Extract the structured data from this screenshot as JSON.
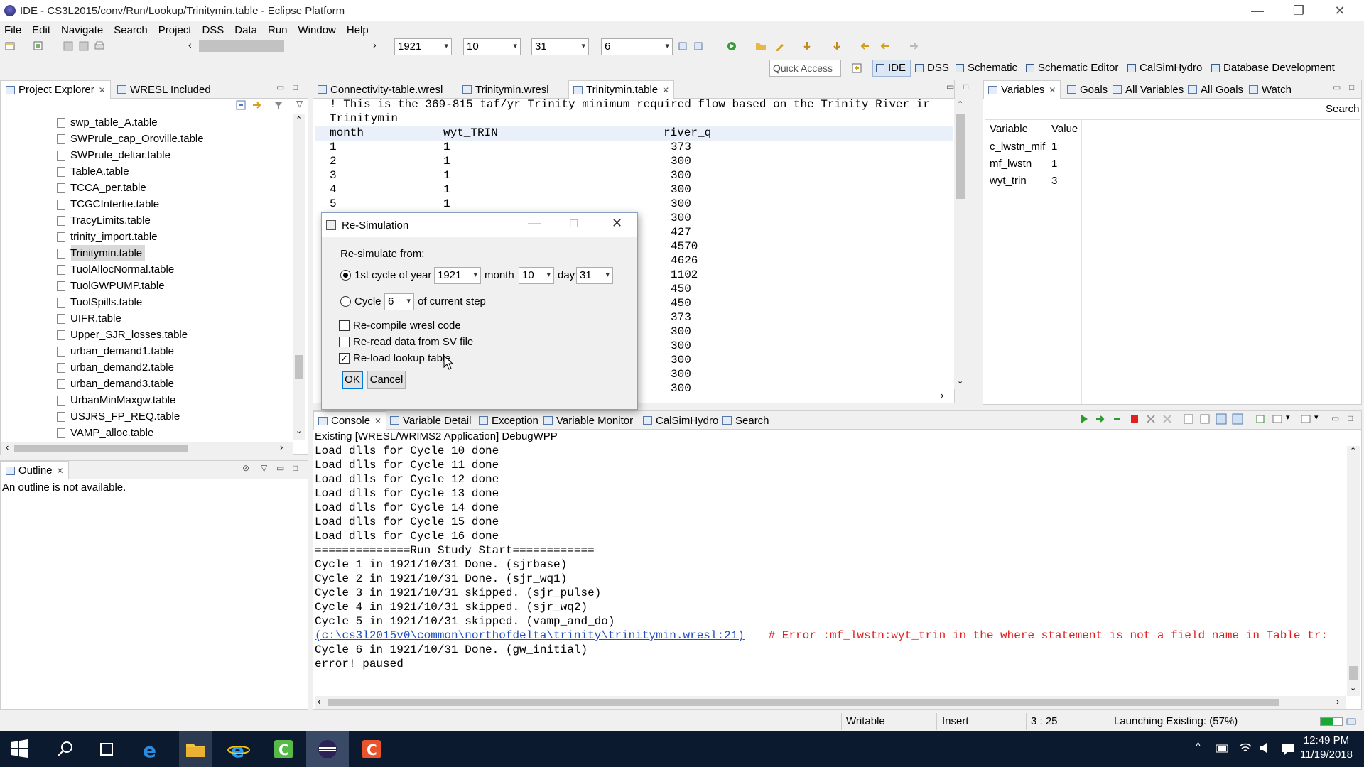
{
  "window": {
    "title": "IDE - CS3L2015/conv/Run/Lookup/Trinitymin.table - Eclipse Platform",
    "minimize": "—",
    "maximize": "❐",
    "close": "✕"
  },
  "menu": [
    "File",
    "Edit",
    "Navigate",
    "Search",
    "Project",
    "DSS",
    "Data",
    "Run",
    "Window",
    "Help"
  ],
  "toolbar": {
    "year": "1921",
    "month": "10",
    "day": "31",
    "cycle": "6",
    "quick_access": "Quick Access"
  },
  "perspectives": [
    "IDE",
    "DSS",
    "Schematic",
    "Schematic Editor",
    "CalSimHydro",
    "Database Development"
  ],
  "project_explorer": {
    "tabs": [
      "Project Explorer",
      "WRESL Included"
    ],
    "items": [
      "swp_table_A.table",
      "SWPrule_cap_Oroville.table",
      "SWPrule_deltar.table",
      "TableA.table",
      "TCCA_per.table",
      "TCGCIntertie.table",
      "TracyLimits.table",
      "trinity_import.table",
      "Trinitymin.table",
      "TuolAllocNormal.table",
      "TuolGWPUMP.table",
      "TuolSpills.table",
      "UIFR.table",
      "Upper_SJR_losses.table",
      "urban_demand1.table",
      "urban_demand2.table",
      "urban_demand3.table",
      "UrbanMinMaxgw.table",
      "USJRS_FP_REQ.table",
      "VAMP_alloc.table"
    ],
    "selected": "Trinitymin.table"
  },
  "outline": {
    "tab": "Outline",
    "message": "An outline is not available."
  },
  "editor": {
    "tabs": [
      "Connectivity-table.wresl",
      "Trinitymin.wresl",
      "Trinitymin.table"
    ],
    "comment_line": "! This is the 369-815 taf/yr Trinity minimum required flow based on the Trinity River ir",
    "name_line": "Trinitymin",
    "headers": [
      "month",
      "wyt_TRIN",
      "river_q"
    ],
    "rows": [
      [
        "1",
        "1",
        "373"
      ],
      [
        "2",
        "1",
        "300"
      ],
      [
        "3",
        "1",
        "300"
      ],
      [
        "4",
        "1",
        "300"
      ],
      [
        "5",
        "1",
        "300"
      ],
      [
        "",
        "",
        "300"
      ],
      [
        "",
        "",
        "427"
      ],
      [
        "",
        "",
        "4570"
      ],
      [
        "",
        "",
        "4626"
      ],
      [
        "",
        "",
        "1102"
      ],
      [
        "",
        "",
        "450"
      ],
      [
        "",
        "",
        "450"
      ],
      [
        "",
        "",
        "373"
      ],
      [
        "",
        "",
        "300"
      ],
      [
        "",
        "",
        "300"
      ],
      [
        "",
        "",
        "300"
      ],
      [
        "",
        "",
        "300"
      ],
      [
        "",
        "",
        "300"
      ]
    ]
  },
  "dialog": {
    "title": "Re-Simulation",
    "resimulate_from": "Re-simulate from:",
    "option1_label": "1st cycle of year",
    "year": "1921",
    "month_label": "month",
    "month": "10",
    "day_label": "day",
    "day": "31",
    "option2_label": "Cycle",
    "cycle": "6",
    "of_current_step": "of current step",
    "recompile": "Re-compile wresl code",
    "reread": "Re-read data from SV file",
    "reload": "Re-load lookup table",
    "ok": "OK",
    "cancel": "Cancel"
  },
  "variables": {
    "tabs": [
      "Variables",
      "Goals",
      "All Variables",
      "All Goals",
      "Watch"
    ],
    "search": "Search",
    "col_variable": "Variable",
    "col_value": "Value",
    "rows": [
      {
        "name": "c_lwstn_mif",
        "value": "1"
      },
      {
        "name": "mf_lwstn",
        "value": "1"
      },
      {
        "name": "wyt_trin",
        "value": "3"
      }
    ]
  },
  "console": {
    "tabs": [
      "Console",
      "Variable Detail",
      "Exception",
      "Variable Monitor",
      "CalSimHydro",
      "Search"
    ],
    "header": "Existing [WRESL/WRIMS2 Application] DebugWPP",
    "lines": [
      "Load dlls for Cycle 10 done",
      "Load dlls for Cycle 11 done",
      "Load dlls for Cycle 12 done",
      "Load dlls for Cycle 13 done",
      "Load dlls for Cycle 14 done",
      "Load dlls for Cycle 15 done",
      "Load dlls for Cycle 16 done",
      "==============Run Study Start============",
      "Cycle 1 in 1921/10/31 Done. (sjrbase)",
      "Cycle 2 in 1921/10/31 Done. (sjr_wq1)",
      "Cycle 3 in 1921/10/31 skipped. (sjr_pulse)",
      "Cycle 4 in 1921/10/31 skipped. (sjr_wq2)",
      "Cycle 5 in 1921/10/31 skipped. (vamp_and_do)"
    ],
    "error_link": "(c:\\cs3l2015v0\\common\\northofdelta\\trinity\\trinitymin.wresl:21)",
    "error_msg": " # Error :mf_lwstn:wyt_trin in the where statement is not a field name in Table tr:",
    "after_lines": [
      "Cycle 6 in 1921/10/31 Done. (gw_initial)",
      "error! paused"
    ]
  },
  "status": {
    "writable": "Writable",
    "insert": "Insert",
    "position": "3 : 25",
    "progress": "Launching Existing: (57%)",
    "progress_value": 0.57
  },
  "taskbar": {
    "time": "12:49 PM",
    "date": "11/19/2018"
  },
  "colors": {
    "error_red": "#e02020",
    "link_blue": "#1f4fbf",
    "selection": "#d9d9d9",
    "taskbar": "#0b1a2e",
    "progress_green": "#19a838"
  }
}
